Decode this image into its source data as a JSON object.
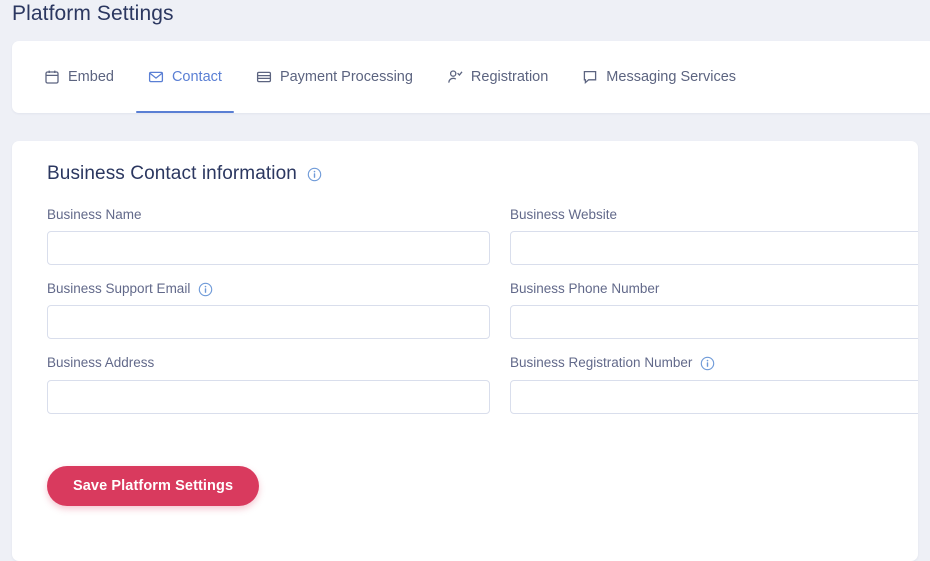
{
  "page": {
    "title": "Platform Settings",
    "background_color": "#EEF0F6"
  },
  "tabs": {
    "active_color": "#5A7FD4",
    "items": [
      {
        "id": "embed",
        "label": "Embed",
        "icon": "calendar-icon",
        "active": false
      },
      {
        "id": "contact",
        "label": "Contact",
        "icon": "envelope-icon",
        "active": true
      },
      {
        "id": "payment-processing",
        "label": "Payment Processing",
        "icon": "credit-card-icon",
        "active": false
      },
      {
        "id": "registration",
        "label": "Registration",
        "icon": "user-check-icon",
        "active": false
      },
      {
        "id": "messaging-services",
        "label": "Messaging Services",
        "icon": "speech-bubble-icon",
        "active": false
      }
    ]
  },
  "form": {
    "heading": "Business Contact information",
    "heading_has_info": true,
    "fields": [
      {
        "id": "business-name",
        "label": "Business Name",
        "value": "",
        "placeholder": "",
        "has_info": false
      },
      {
        "id": "business-website",
        "label": "Business Website",
        "value": "",
        "placeholder": "",
        "has_info": false
      },
      {
        "id": "business-support-email",
        "label": "Business Support Email",
        "value": "",
        "placeholder": "",
        "has_info": true
      },
      {
        "id": "business-phone-number",
        "label": "Business Phone Number",
        "value": "",
        "placeholder": "",
        "has_info": false
      },
      {
        "id": "business-address",
        "label": "Business Address",
        "value": "",
        "placeholder": "",
        "has_info": false
      },
      {
        "id": "business-registration-number",
        "label": "Business Registration Number",
        "value": "",
        "placeholder": "",
        "has_info": true
      }
    ],
    "save_label": "Save Platform Settings",
    "save_color": "#D93A5E"
  }
}
